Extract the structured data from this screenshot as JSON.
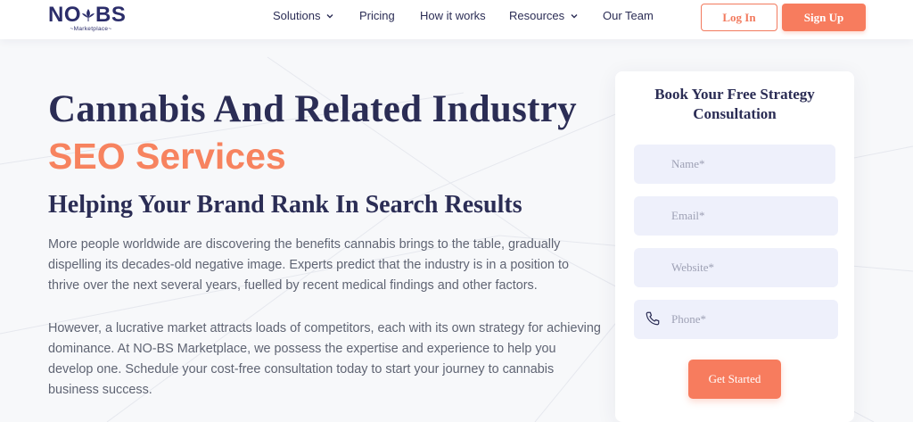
{
  "brand": {
    "logo_left": "NO",
    "logo_right": "BS",
    "logo_sub": "Marketplace",
    "accent_color": "#f77c5e",
    "primary_color": "#2b2d55"
  },
  "nav": {
    "items": [
      {
        "label": "Solutions",
        "has_dropdown": true
      },
      {
        "label": "Pricing",
        "has_dropdown": false
      },
      {
        "label": "How it works",
        "has_dropdown": false
      },
      {
        "label": "Resources",
        "has_dropdown": true
      },
      {
        "label": "Our Team",
        "has_dropdown": false
      }
    ],
    "login_label": "Log In",
    "signup_label": "Sign Up"
  },
  "hero": {
    "title": "Cannabis And Related Industry",
    "accent": "SEO Services",
    "subtitle": "Helping Your Brand Rank In Search Results",
    "paragraph1": "More people worldwide are discovering the benefits cannabis brings to the table, gradually dispelling its decades-old negative image. Experts predict that the industry is in a position to thrive over the next several years, fuelled by recent medical findings and other factors.",
    "paragraph2": "However, a lucrative market attracts loads of competitors, each with its own strategy for achieving dominance. At NO-BS Marketplace, we possess the expertise and experience to help you develop one. Schedule your cost-free consultation today to start your journey to cannabis business success."
  },
  "form": {
    "title_line1": "Book Your Free Strategy",
    "title_line2": "Consultation",
    "fields": {
      "name": {
        "placeholder": "Name*",
        "value": ""
      },
      "email": {
        "placeholder": "Email*",
        "value": ""
      },
      "website": {
        "placeholder": "Website*",
        "value": ""
      },
      "phone": {
        "placeholder": "Phone*",
        "value": ""
      }
    },
    "submit_label": "Get Started",
    "phone_icon": "phone-icon"
  }
}
